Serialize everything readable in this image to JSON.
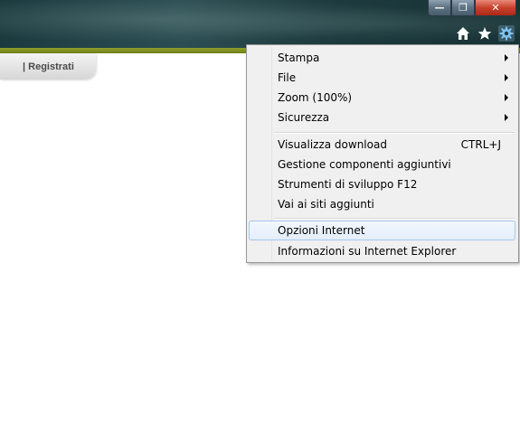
{
  "window_controls": {
    "minimize": "—",
    "maximize": "❐",
    "close": "✕"
  },
  "toolbar": {
    "icons": [
      "home-icon",
      "favorites-star-icon",
      "tools-gear-icon"
    ]
  },
  "page": {
    "tab_label": "| Registrati"
  },
  "menu": {
    "items": [
      {
        "label": "Stampa",
        "submenu": true
      },
      {
        "label": "File",
        "submenu": true
      },
      {
        "label": "Zoom (100%)",
        "submenu": true
      },
      {
        "label": "Sicurezza",
        "submenu": true
      },
      {
        "label": "Visualizza download",
        "shortcut": "CTRL+J"
      },
      {
        "label": "Gestione componenti aggiuntivi"
      },
      {
        "label": "Strumenti di sviluppo F12"
      },
      {
        "label": "Vai ai siti aggiunti"
      },
      {
        "label": "Opzioni Internet",
        "highlighted": true
      },
      {
        "label": "Informazioni su Internet Explorer"
      }
    ]
  },
  "colors": {
    "banner": "#1d3a3e",
    "accent_stripe": "#7f9220",
    "menu_background": "#f0f0f0",
    "menu_hover": "#e4eefb",
    "close_button": "#c8412c"
  }
}
